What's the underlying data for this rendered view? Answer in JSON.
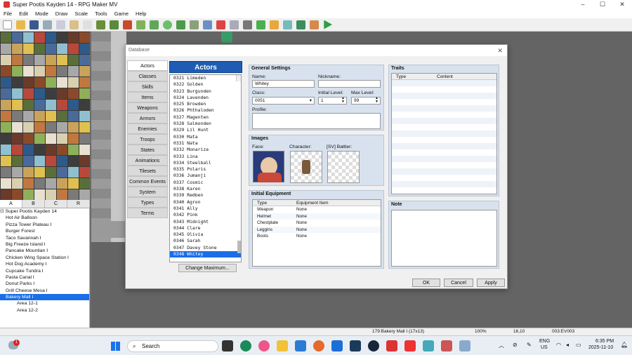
{
  "window": {
    "title": "Super Pootis Kayden 14 - RPG Maker MV",
    "minimize": "–",
    "maximize": "☐",
    "close": "✕"
  },
  "menu": [
    "File",
    "Edit",
    "Mode",
    "Draw",
    "Scale",
    "Tools",
    "Game",
    "Help"
  ],
  "palette_tabs": [
    "A",
    "B",
    "C",
    "R"
  ],
  "map_tree": {
    "root": "Super Pootis Kayden 14",
    "items": [
      "Hot Air Balloon",
      "Pizza Tower Plateau I",
      "Burger Forest",
      "Taco Savannah I",
      "Big Freeze Island I",
      "Pancake Mountian I",
      "Chicken Wing Space Station I",
      "Hot Dog Academy I",
      "Cupcake Tundra I",
      "Pasta Canal I",
      "Donut Parks I",
      "Grill Cheese Mesa I",
      "Bakery Mall I",
      "Area 12-1",
      "Area 12-2"
    ],
    "selected": "Bakery Mall I"
  },
  "status": {
    "map": "179:Bakery Mall I (17x13)",
    "zoom": "100%",
    "coords": "16,10",
    "event": "003:EV003"
  },
  "taskbar": {
    "search": "Search",
    "lang1": "ENG",
    "lang2": "US",
    "time": "6:35 PM",
    "date": "2025-11-10",
    "badge": "1"
  },
  "dialog": {
    "title": "Database",
    "categories": [
      "Actors",
      "Classes",
      "Skills",
      "Items",
      "Weapons",
      "Armors",
      "Enemies",
      "Troops",
      "States",
      "Animations",
      "Tilesets",
      "Common Events",
      "System",
      "Types",
      "Terms"
    ],
    "active_category": "Actors",
    "list_header": "Actors",
    "actors": [
      "0321 Limeden",
      "0322 Golden",
      "0323 Burgunden",
      "0324 Lavenden",
      "0325 Browden",
      "0326 Phthaloden",
      "0327 Magenten",
      "0328 Salmonden",
      "0329 Lil Hunt",
      "0330 Mata",
      "0331 Nata",
      "0332 Monariza",
      "0333 Lina",
      "0334 Steelball",
      "0335 Polaris",
      "0336 Jumanji",
      "0337 Cosmic",
      "0338 Karen",
      "0339 Redben",
      "0340 Agron",
      "0341 Ally",
      "0342 Pink",
      "0343 Midnight",
      "0344 Clare",
      "0345 Olivia",
      "0346 Sarah",
      "0347 Davey Stone",
      "0348 Whitey"
    ],
    "selected_actor": "0348 Whitey",
    "change_max": "Change Maximum...",
    "general": {
      "title": "General Settings",
      "name_label": "Name:",
      "name": "Whitey",
      "nickname_label": "Nickname:",
      "nickname": "",
      "class_label": "Class:",
      "class": "0051",
      "initial_level_label": "Initial Level:",
      "initial_level": "1",
      "max_level_label": "Max Level:",
      "max_level": "99",
      "profile_label": "Profile:",
      "profile": ""
    },
    "images": {
      "title": "Images",
      "face": "Face:",
      "character": "Character:",
      "battler": "[SV] Battler:"
    },
    "equipment": {
      "title": "Initial Equipment",
      "col_type": "Type",
      "col_item": "Equipment Item",
      "rows": [
        {
          "type": "Weapon",
          "item": "None"
        },
        {
          "type": "Helmet",
          "item": "None"
        },
        {
          "type": "Chestplate",
          "item": "None"
        },
        {
          "type": "Leggins",
          "item": "None"
        },
        {
          "type": "Boots",
          "item": "None"
        }
      ]
    },
    "traits": {
      "title": "Traits",
      "col_type": "Type",
      "col_content": "Content"
    },
    "note": {
      "title": "Note"
    },
    "buttons": {
      "ok": "OK",
      "cancel": "Cancel",
      "apply": "Apply"
    }
  }
}
